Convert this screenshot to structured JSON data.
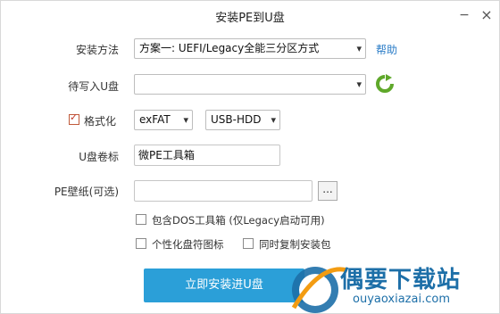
{
  "window": {
    "title": "安装PE到U盘",
    "minimize_label": "−",
    "close_label": "×"
  },
  "form": {
    "install_method": {
      "label": "安装方法",
      "value": "方案一: UEFI/Legacy全能三分区方式",
      "help_label": "帮助"
    },
    "target_drive": {
      "label": "待写入U盘",
      "value": ""
    },
    "format": {
      "label": "格式化",
      "checked": true,
      "filesystem": "exFAT",
      "mode": "USB-HDD"
    },
    "volume_label": {
      "label": "U盘卷标",
      "value": "微PE工具箱"
    },
    "wallpaper": {
      "label": "PE壁纸(可选)",
      "value": "",
      "browse_label": "..."
    },
    "options": [
      {
        "label": "包含DOS工具箱 (仅Legacy启动可用)",
        "checked": false
      },
      {
        "label": "个性化盘符图标",
        "checked": false
      },
      {
        "label": "同时复制安装包",
        "checked": false
      }
    ]
  },
  "actions": {
    "install_label": "立即安装进U盘"
  },
  "watermark": {
    "brand": "偶要下载站",
    "url": "ouyaoxiazai.com"
  },
  "colors": {
    "accent": "#2b9fd8",
    "refresh": "#5fa82a",
    "link": "#2a7cc7"
  }
}
